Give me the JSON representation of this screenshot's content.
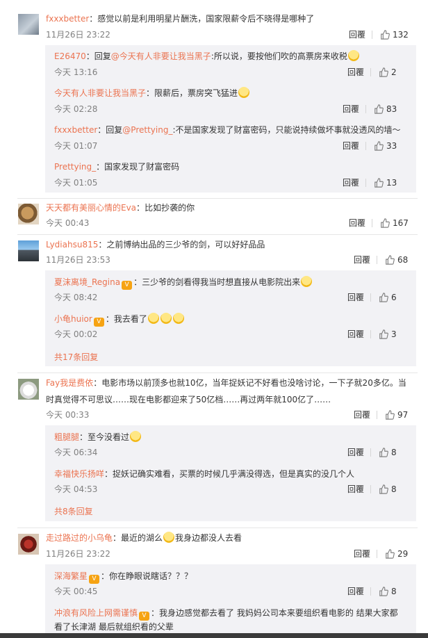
{
  "labels": {
    "reply": "回覆",
    "colon": "："
  },
  "comments": [
    {
      "user": "fxxxbetter",
      "text": "感觉以前是利用明星片酬洗，国家限薪令后不晓得是哪种了",
      "time": "11月26日 23:22",
      "likes": "132"
    },
    {
      "user": "天天都有美丽心情的Eva",
      "text": "比如抄袭的你",
      "time": "今天 00:43",
      "likes": "167"
    },
    {
      "user": "Lydiahsu815",
      "text": "之前博纳出品的三少爷的剑，可以好好品品",
      "time": "11月26日 23:53",
      "likes": "68",
      "more": "共17条回复"
    },
    {
      "user": "Fay我是费依",
      "text": "电影市场以前顶多也就10亿，当年捉妖记不好看也没啥讨论，一下子就20多亿。当",
      "text2": "时真觉得不可思议……现在电影都迎来了50亿档……再过两年就100亿了……",
      "time": "今天 00:33",
      "likes": "97",
      "more": "共8条回复"
    },
    {
      "user": "走过路过的小乌龟",
      "text": "最近的湖么",
      "text_after": "我身边都没人去看",
      "time": "11月26日 23:22",
      "likes": "29"
    }
  ],
  "replies": {
    "c0": [
      {
        "user": "E26470",
        "prefix": "回复",
        "mention": "@今天有人非要让我当黑子",
        "text": ":所以说，要按他们吹的高票房来收税",
        "time": "今天 13:16",
        "likes": "2"
      },
      {
        "user": "今天有人非要让我当黑子",
        "text": "限薪后，票房突飞猛进",
        "time": "今天 02:28",
        "likes": "83"
      },
      {
        "user": "fxxxbetter",
        "prefix": "回复",
        "mention": "@Prettying_",
        "text": ":不是国家发现了财富密码，只能说持续做坏事就没透风的墙～",
        "time": "今天 01:07",
        "likes": "33"
      },
      {
        "user": "Prettying_",
        "text": "国家发现了财富密码",
        "time": "今天 01:05",
        "likes": "13"
      }
    ],
    "c2": [
      {
        "user": "夏沫离境_Regina",
        "text": "三少爷的剑看得我当时想直接从电影院出来",
        "time": "今天 08:42",
        "likes": "6"
      },
      {
        "user": "小龟huior",
        "text": "我去看了",
        "time": "今天 00:02",
        "likes": "3"
      }
    ],
    "c3": [
      {
        "user": "粗腿腿",
        "text": "至今没看过",
        "time": "今天 06:34",
        "likes": "8"
      },
      {
        "user": "幸福快乐扬咩",
        "text": "捉妖记确实难看，买票的时候几乎满没得选，但是真实的没几个人",
        "time": "今天 04:53",
        "likes": "8"
      }
    ],
    "c4": [
      {
        "user": "深海繁星",
        "text": "你在睁眼说瞎话？？？",
        "time": "今天 00:45",
        "likes": "8"
      },
      {
        "user": "冲浪有风险上网需谨慎",
        "text": "我身边感觉都去看了 我妈妈公司本来要组织看电影的 结果大家都",
        "text2": "看了长津湖 最后就组织看的父辈"
      }
    ]
  },
  "icon_names": {
    "like": "thumbs-up-icon",
    "emoji": "smiley-emoji-icon",
    "vip": "vip-badge-icon"
  },
  "colors": {
    "link": "#eb7350",
    "text": "#333333",
    "muted": "#808080",
    "reply_bg": "#f2f2f5"
  }
}
